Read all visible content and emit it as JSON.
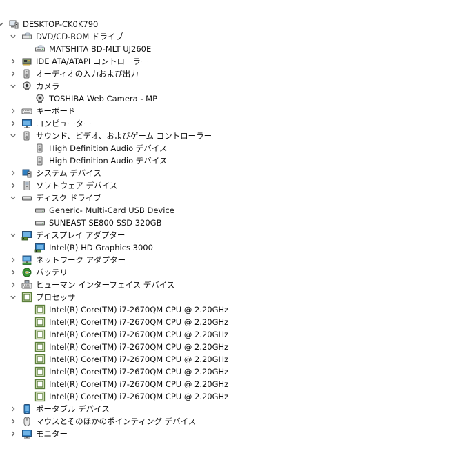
{
  "device_tree": {
    "root": {
      "label": "DESKTOP-CK0K790",
      "icon": "computer-root-icon",
      "expanded": true
    },
    "categories": [
      {
        "label": "DVD/CD-ROM ドライブ",
        "icon": "dvd-drive-icon",
        "expanded": true,
        "children": [
          {
            "label": "MATSHITA BD-MLT UJ260E",
            "icon": "dvd-drive-icon"
          }
        ]
      },
      {
        "label": "IDE ATA/ATAPI コントローラー",
        "icon": "ide-controller-icon",
        "expanded": false,
        "children": []
      },
      {
        "label": "オーディオの入力および出力",
        "icon": "speaker-icon",
        "expanded": false,
        "children": []
      },
      {
        "label": "カメラ",
        "icon": "camera-icon",
        "expanded": true,
        "children": [
          {
            "label": "TOSHIBA Web Camera - MP",
            "icon": "camera-icon"
          }
        ]
      },
      {
        "label": "キーボード",
        "icon": "keyboard-icon",
        "expanded": false,
        "children": []
      },
      {
        "label": "コンピューター",
        "icon": "monitor-icon",
        "expanded": false,
        "children": []
      },
      {
        "label": "サウンド、ビデオ、およびゲーム コントローラー",
        "icon": "speaker-icon",
        "expanded": true,
        "children": [
          {
            "label": "High Definition Audio デバイス",
            "icon": "speaker-icon"
          },
          {
            "label": "High Definition Audio デバイス",
            "icon": "speaker-icon"
          }
        ]
      },
      {
        "label": "システム デバイス",
        "icon": "system-device-icon",
        "expanded": false,
        "children": []
      },
      {
        "label": "ソフトウェア デバイス",
        "icon": "software-device-icon",
        "expanded": false,
        "children": []
      },
      {
        "label": "ディスク ドライブ",
        "icon": "disk-drive-icon",
        "expanded": true,
        "children": [
          {
            "label": "Generic- Multi-Card USB Device",
            "icon": "disk-drive-icon"
          },
          {
            "label": "SUNEAST SE800 SSD 320GB",
            "icon": "disk-drive-icon"
          }
        ]
      },
      {
        "label": "ディスプレイ アダプター",
        "icon": "display-adapter-icon",
        "expanded": true,
        "children": [
          {
            "label": "Intel(R) HD Graphics 3000",
            "icon": "display-adapter-icon"
          }
        ]
      },
      {
        "label": "ネットワーク アダプター",
        "icon": "network-adapter-icon",
        "expanded": false,
        "children": []
      },
      {
        "label": "バッテリ",
        "icon": "battery-icon",
        "expanded": false,
        "children": []
      },
      {
        "label": "ヒューマン インターフェイス デバイス",
        "icon": "hid-icon",
        "expanded": false,
        "children": []
      },
      {
        "label": "プロセッサ",
        "icon": "processor-icon",
        "expanded": true,
        "children": [
          {
            "label": "Intel(R) Core(TM) i7-2670QM CPU @ 2.20GHz",
            "icon": "processor-icon"
          },
          {
            "label": "Intel(R) Core(TM) i7-2670QM CPU @ 2.20GHz",
            "icon": "processor-icon"
          },
          {
            "label": "Intel(R) Core(TM) i7-2670QM CPU @ 2.20GHz",
            "icon": "processor-icon"
          },
          {
            "label": "Intel(R) Core(TM) i7-2670QM CPU @ 2.20GHz",
            "icon": "processor-icon"
          },
          {
            "label": "Intel(R) Core(TM) i7-2670QM CPU @ 2.20GHz",
            "icon": "processor-icon"
          },
          {
            "label": "Intel(R) Core(TM) i7-2670QM CPU @ 2.20GHz",
            "icon": "processor-icon"
          },
          {
            "label": "Intel(R) Core(TM) i7-2670QM CPU @ 2.20GHz",
            "icon": "processor-icon"
          },
          {
            "label": "Intel(R) Core(TM) i7-2670QM CPU @ 2.20GHz",
            "icon": "processor-icon"
          }
        ]
      },
      {
        "label": "ポータブル デバイス",
        "icon": "portable-device-icon",
        "expanded": false,
        "children": []
      },
      {
        "label": "マウスとそのほかのポインティング デバイス",
        "icon": "mouse-icon",
        "expanded": false,
        "children": []
      },
      {
        "label": "モニター",
        "icon": "monitor-icon",
        "expanded": false,
        "children": []
      }
    ]
  },
  "colors": {
    "text": "#111111",
    "chevron": "#5a5a5a",
    "monitor_blue": "#2f7fc1",
    "chip_green": "#5b7f3a",
    "battery_green": "#3b9b34",
    "device_gray": "#808080"
  }
}
